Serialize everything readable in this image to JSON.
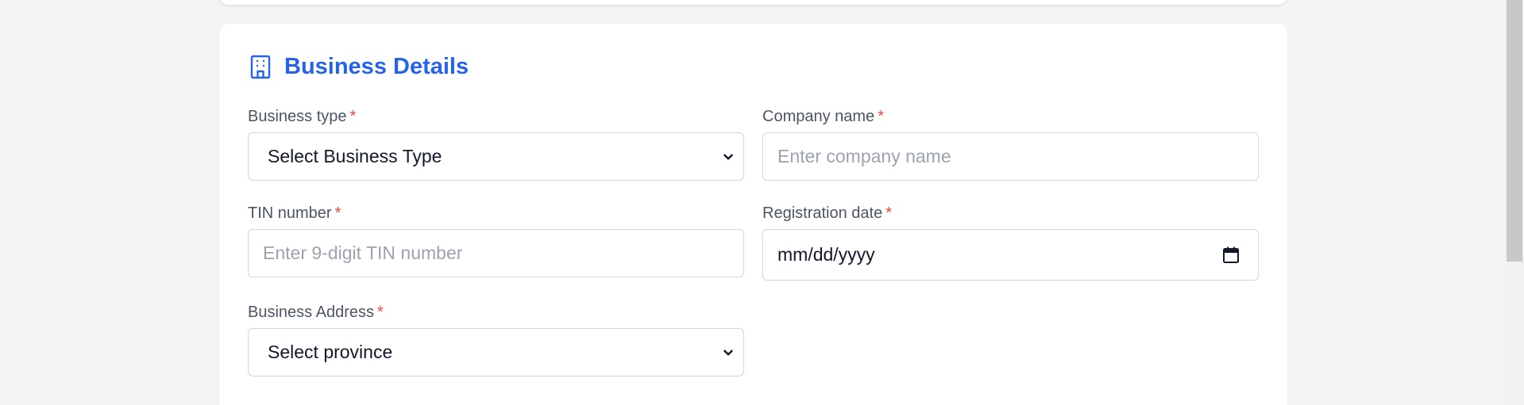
{
  "section": {
    "title": "Business Details",
    "icon": "building-icon",
    "accent_color": "#2563eb"
  },
  "fields": {
    "business_type": {
      "label": "Business type",
      "required_mark": "*",
      "selected": "Select Business Type"
    },
    "company_name": {
      "label": "Company name",
      "required_mark": "*",
      "placeholder": "Enter company name"
    },
    "tin_number": {
      "label": "TIN number",
      "required_mark": "*",
      "placeholder": "Enter 9-digit TIN number"
    },
    "registration_date": {
      "label": "Registration date",
      "required_mark": "*",
      "value": "mm/dd/yyyy",
      "icon": "calendar-icon"
    },
    "business_address": {
      "label": "Business Address",
      "required_mark": "*",
      "selected": "Select province"
    }
  },
  "colors": {
    "required": "#ef4444",
    "label": "#4b5563",
    "placeholder": "#9ca3af",
    "border": "#d1d5db",
    "background": "#f3f4f6"
  }
}
